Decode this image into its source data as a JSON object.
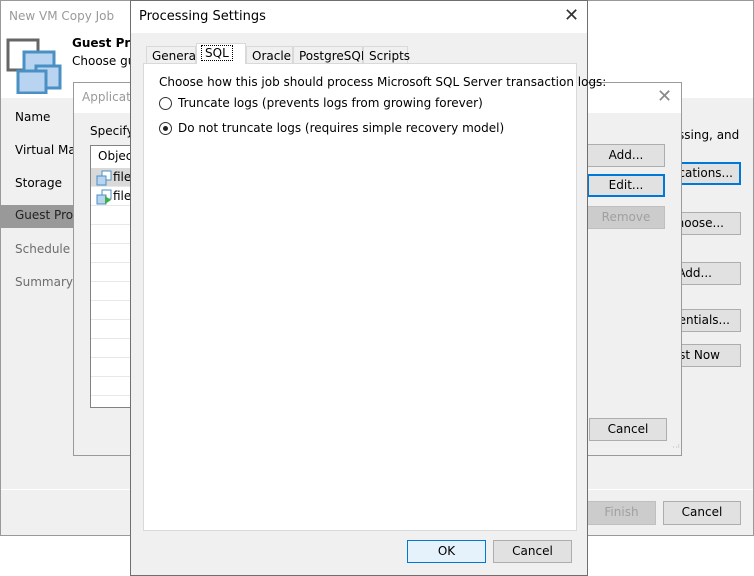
{
  "background_window": {
    "title": "New VM Copy Job",
    "header_title": "Guest Proc",
    "header_subtitle": "Choose gu",
    "nav": [
      "Name",
      "Virtual Mac",
      "Storage",
      "Guest Proc",
      "Schedule",
      "Summary"
    ],
    "selected_nav": "Guest Proc",
    "right_text": "ssing, and",
    "right_buttons": [
      "ications...",
      "hoose...",
      "Add...",
      "dentials...",
      "st Now"
    ],
    "finish_label": "Finish",
    "cancel_label": "Cancel"
  },
  "app_dialog": {
    "title": "Applicati",
    "specify_label": "Specify",
    "list_header": "Object",
    "rows": [
      "file",
      "file"
    ],
    "add_label": "Add...",
    "edit_label": "Edit...",
    "remove_label": "Remove",
    "cancel_label": "Cancel"
  },
  "processing_settings": {
    "title": "Processing Settings",
    "tabs": [
      "General",
      "SQL",
      "Oracle",
      "PostgreSQL",
      "Scripts"
    ],
    "active_tab": "SQL",
    "prompt": "Choose how this job should process Microsoft SQL Server transaction logs:",
    "options": [
      {
        "label": "Truncate logs (prevents logs from growing forever)",
        "selected": false
      },
      {
        "label": "Do not truncate logs (requires simple recovery model)",
        "selected": true
      }
    ],
    "ok_label": "OK",
    "cancel_label": "Cancel"
  },
  "colors": {
    "accent": "#0078d7",
    "nav_selected": "#999999",
    "icon_fill": "#b8d4f0",
    "icon_stroke": "#4a90c4"
  }
}
